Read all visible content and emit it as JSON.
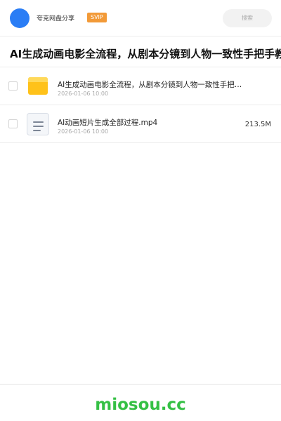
{
  "header": {
    "user_name": "夸克网盘分享",
    "badge": "SVIP",
    "search_label": "搜索"
  },
  "share": {
    "title": "AI生成动画电影全流程，从剧本分镜到人物一致性手把手教"
  },
  "files": [
    {
      "type": "folder",
      "icon": "folder-icon",
      "name": "AI生成动画电影全流程，从剧本分镜到人物一致性手把…",
      "date": "2026-01-06 10:00",
      "size": ""
    },
    {
      "type": "file",
      "icon": "document-icon",
      "name": "AI动画短片生成全部过程.mp4",
      "date": "2026-01-06 10:00",
      "size": "213.5M"
    }
  ],
  "footer": {
    "brand": "miosou.cc"
  },
  "colors": {
    "avatar": "#2a7df5",
    "badge": "#f29a38",
    "folder": "#ffc21a",
    "brand": "#35c045"
  }
}
